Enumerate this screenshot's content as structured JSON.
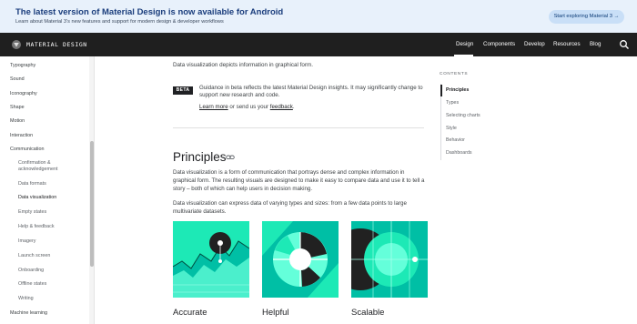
{
  "banner": {
    "title": "The latest version of Material Design is now available for Android",
    "subtitle": "Learn about Material 3’s new features and support for modern design & developer workflows",
    "button_label": "Start exploring Material 3",
    "button_arrow": "→"
  },
  "topnav": {
    "brand": "MATERIAL DESIGN",
    "items": [
      {
        "label": "Design",
        "active": true
      },
      {
        "label": "Components"
      },
      {
        "label": "Develop"
      },
      {
        "label": "Resources"
      },
      {
        "label": "Blog"
      }
    ],
    "search_icon": "search-icon",
    "logo_icon": "material-logo-icon"
  },
  "sidebar": {
    "items": [
      {
        "label": "Typography"
      },
      {
        "label": "Sound"
      },
      {
        "label": "Iconography"
      },
      {
        "label": "Shape"
      },
      {
        "label": "Motion"
      },
      {
        "label": "Interaction"
      },
      {
        "label": "Communication",
        "expanded": true
      },
      {
        "label": "Confirmation &"
      },
      {
        "label": "acknowledgement"
      },
      {
        "label": "Data formats"
      },
      {
        "label": "Data visualization",
        "active": true
      },
      {
        "label": "Empty states"
      },
      {
        "label": "Help & feedback"
      },
      {
        "label": "Imagery"
      },
      {
        "label": "Launch screen"
      },
      {
        "label": "Onboarding"
      },
      {
        "label": "Offline states"
      },
      {
        "label": "Writing"
      },
      {
        "label": "Machine learning"
      }
    ]
  },
  "main": {
    "intro": "Data visualization depicts information in graphical form.",
    "beta": {
      "badge": "BETA",
      "text": "Guidance in beta reflects the latest Material Design insights. It may significantly change to support new research and code.",
      "learn_more": "Learn more",
      "or_send": " or send us your ",
      "feedback": "feedback",
      "period": "."
    },
    "principles": {
      "heading": "Principles",
      "para1": "Data visualization is a form of communication that portrays dense and complex information in graphical form. The resulting visuals are designed to make it easy to compare data and use it to tell a story – both of which can help users in decision making.",
      "para2": "Data visualization can express data of varying types and sizes: from a few data points to large multivariate datasets.",
      "cards": [
        {
          "title": "Accurate"
        },
        {
          "title": "Helpful"
        },
        {
          "title": "Scalable"
        }
      ]
    }
  },
  "toc": {
    "label": "CONTENTS",
    "items": [
      {
        "label": "Principles",
        "active": true
      },
      {
        "label": "Types"
      },
      {
        "label": "Selecting charts"
      },
      {
        "label": "Style"
      },
      {
        "label": "Behavior"
      },
      {
        "label": "Dashboards"
      }
    ]
  },
  "colors": {
    "banner_bg": "#e8f1fb",
    "nav_bg": "#1f1f1f",
    "accent_teal": "#1de9b6",
    "accent_dark": "#00bfa5",
    "ink": "#202124"
  }
}
